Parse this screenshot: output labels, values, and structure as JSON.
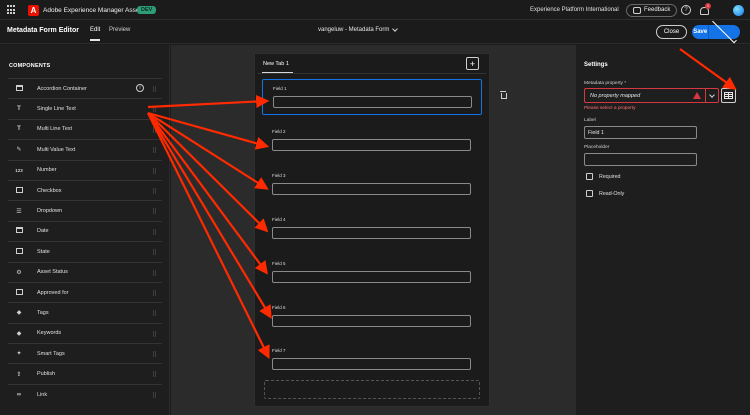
{
  "topbar": {
    "app_title": "Adobe Experience Manager Assets",
    "env_badge": "DEV",
    "org": "Experience Platform International",
    "feedback_label": "Feedback",
    "help_glyph": "?",
    "notification_count": "1",
    "icons": [
      "app-switcher-icon",
      "adobe-logo",
      "feedback-icon",
      "help-icon",
      "bell-icon",
      "avatar"
    ]
  },
  "editor": {
    "title": "Metadata Form Editor",
    "tabs": [
      {
        "label": "Edit"
      },
      {
        "label": "Preview"
      }
    ],
    "form_name": "vangeluw - Metadata Form",
    "close_label": "Close",
    "save_label": "Save"
  },
  "components": {
    "heading": "COMPONENTS",
    "items": [
      {
        "label": "Accordion Container",
        "icon": "accordion-icon"
      },
      {
        "label": "Single Line Text",
        "icon": "text-icon"
      },
      {
        "label": "Multi Line Text",
        "icon": "text-icon"
      },
      {
        "label": "Multi Value Text",
        "icon": "multi-value-icon"
      },
      {
        "label": "Number",
        "icon": "number-icon"
      },
      {
        "label": "Checkbox",
        "icon": "checkbox-icon"
      },
      {
        "label": "Dropdown",
        "icon": "dropdown-icon"
      },
      {
        "label": "Date",
        "icon": "date-icon"
      },
      {
        "label": "State",
        "icon": "state-icon"
      },
      {
        "label": "Asset Status",
        "icon": "asset-status-icon"
      },
      {
        "label": "Approved for",
        "icon": "approved-icon"
      },
      {
        "label": "Tags",
        "icon": "tag-icon"
      },
      {
        "label": "Keywords",
        "icon": "keyword-icon"
      },
      {
        "label": "Smart Tags",
        "icon": "smart-tag-icon"
      },
      {
        "label": "Publish",
        "icon": "publish-icon"
      },
      {
        "label": "Link",
        "icon": "link-icon"
      }
    ]
  },
  "form": {
    "tab_label": "New Tab 1",
    "add_tab_glyph": "+",
    "fields": [
      {
        "label": "Field 1"
      },
      {
        "label": "Field 2"
      },
      {
        "label": "Field 3"
      },
      {
        "label": "Field 4"
      },
      {
        "label": "Field 5"
      },
      {
        "label": "Field 6"
      },
      {
        "label": "Field 7"
      }
    ]
  },
  "settings": {
    "title": "Settings",
    "metadata_property_label": "Metadata property",
    "required_marker": "*",
    "metadata_property_placeholder": "No property mapped",
    "error_message": "Please select a property",
    "label_label": "Label",
    "label_value": "Field 1",
    "placeholder_label": "Placeholder",
    "placeholder_value": "",
    "required_label": "Required",
    "readonly_label": "Read-Only"
  },
  "colors": {
    "accent": "#1473e6",
    "error": "#d7373f",
    "annotation_arrow": "#ff2a00",
    "adobe_red": "#eb1000",
    "dev_badge": "#2d9d78"
  }
}
